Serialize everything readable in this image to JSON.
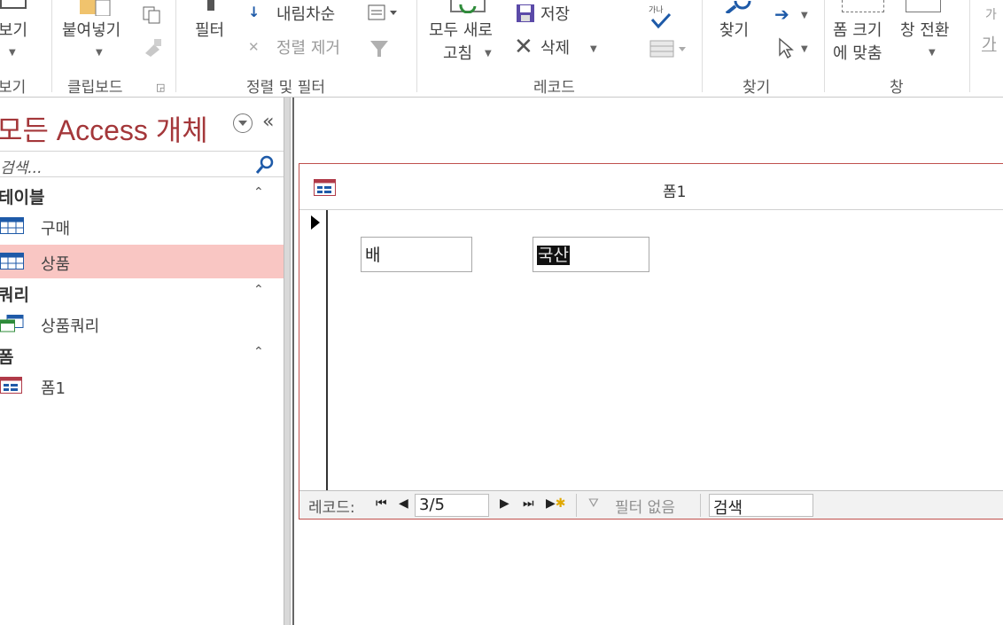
{
  "ribbon": {
    "view": {
      "label": "보기",
      "group": "보기"
    },
    "clipboard": {
      "paste_label": "붙여넣기",
      "group": "클립보드"
    },
    "sort_filter": {
      "filter_label": "필터",
      "descending_label": "내림차순",
      "remove_sort_label": "정렬 제거",
      "group": "정렬 및 필터"
    },
    "records": {
      "refresh_label_1": "모두 새로",
      "refresh_label_2": "고침",
      "save_label": "저장",
      "delete_label": "삭제",
      "group": "레코드"
    },
    "find": {
      "find_label": "찾기",
      "group": "찾기"
    },
    "window": {
      "fit_label_1": "폼 크기",
      "fit_label_2": "에 맞춤",
      "switch_label_1": "창 전환",
      "group": "창"
    },
    "text_format": {
      "label_1": "가",
      "label_2": "가"
    }
  },
  "nav": {
    "title": "모든 Access 개체",
    "collapse": "«",
    "search_placeholder": "검색...",
    "sections": [
      {
        "label": "테이블",
        "items": [
          {
            "label": "구매"
          },
          {
            "label": "상품"
          }
        ]
      },
      {
        "label": "쿼리",
        "items": [
          {
            "label": "상품쿼리"
          }
        ]
      },
      {
        "label": "폼",
        "items": [
          {
            "label": "폼1"
          }
        ]
      }
    ],
    "selected_item": "상품"
  },
  "form": {
    "title": "폼1",
    "fields": {
      "name_value": "배",
      "origin_value": "국산"
    },
    "record_nav": {
      "label": "레코드:",
      "position": "3/5",
      "filter_label": "필터 없음",
      "search_label": "검색"
    }
  },
  "colors": {
    "accent": "#a4373a",
    "selected_item_bg": "#f9c6c3",
    "form_border": "#c0504d"
  }
}
